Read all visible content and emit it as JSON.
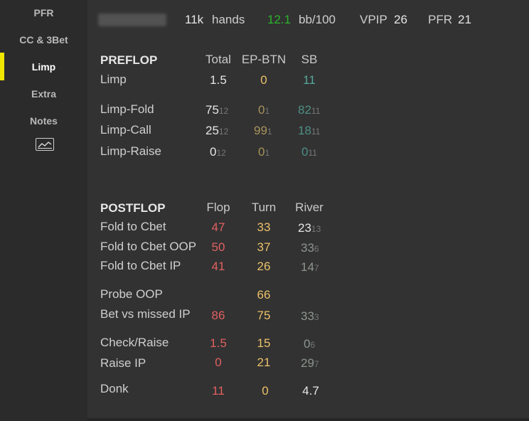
{
  "sidebar": {
    "items": [
      {
        "label": "PFR"
      },
      {
        "label": "CC & 3Bet"
      },
      {
        "label": "Limp"
      },
      {
        "label": "Extra"
      },
      {
        "label": "Notes"
      }
    ],
    "active": "Limp",
    "chart_icon": "line-chart-icon"
  },
  "header": {
    "hands_value": "11k",
    "hands_label": "hands",
    "bb100_value": "12.1",
    "bb100_label": "bb/100",
    "vpip_label": "VPIP",
    "vpip_value": "26",
    "pfr_label": "PFR",
    "pfr_value": "21"
  },
  "preflop": {
    "title": "PREFLOP",
    "columns": [
      "Total",
      "EP-BTN",
      "SB"
    ],
    "rows": [
      {
        "label": "Limp",
        "cells": [
          {
            "v": "1.5"
          },
          {
            "v": "0"
          },
          {
            "v": "11"
          }
        ]
      },
      {
        "label": "Limp-Fold",
        "cells": [
          {
            "v": "75",
            "s": "12"
          },
          {
            "v": "0",
            "s": "1"
          },
          {
            "v": "82",
            "s": "11"
          }
        ]
      },
      {
        "label": "Limp-Call",
        "cells": [
          {
            "v": "25",
            "s": "12"
          },
          {
            "v": "99",
            "s": "1"
          },
          {
            "v": "18",
            "s": "11"
          }
        ]
      },
      {
        "label": "Limp-Raise",
        "cells": [
          {
            "v": "0",
            "s": "12"
          },
          {
            "v": "0",
            "s": "1"
          },
          {
            "v": "0",
            "s": "11"
          }
        ]
      }
    ]
  },
  "postflop": {
    "title": "POSTFLOP",
    "columns": [
      "Flop",
      "Turn",
      "River"
    ],
    "rows": [
      {
        "label": "Fold to Cbet",
        "cells": [
          {
            "v": "47"
          },
          {
            "v": "33"
          },
          {
            "v": "23",
            "s": "13"
          }
        ]
      },
      {
        "label": "Fold to Cbet OOP",
        "cells": [
          {
            "v": "50"
          },
          {
            "v": "37"
          },
          {
            "v": "33",
            "s": "6"
          }
        ]
      },
      {
        "label": "Fold to Cbet IP",
        "cells": [
          {
            "v": "41"
          },
          {
            "v": "26"
          },
          {
            "v": "14",
            "s": "7"
          }
        ]
      },
      {
        "label": "Probe OOP",
        "cells": [
          {
            "v": ""
          },
          {
            "v": "66"
          },
          {
            "v": ""
          }
        ]
      },
      {
        "label": "Bet vs missed IP",
        "cells": [
          {
            "v": "86"
          },
          {
            "v": "75"
          },
          {
            "v": "33",
            "s": "3"
          }
        ]
      },
      {
        "label": "Check/Raise",
        "cells": [
          {
            "v": "1.5"
          },
          {
            "v": "15"
          },
          {
            "v": "0",
            "s": "6"
          }
        ]
      },
      {
        "label": "Raise IP",
        "cells": [
          {
            "v": "0"
          },
          {
            "v": "21"
          },
          {
            "v": "29",
            "s": "7"
          }
        ]
      },
      {
        "label": "Donk",
        "cells": [
          {
            "v": "11"
          },
          {
            "v": "0"
          },
          {
            "v": "4.7"
          }
        ]
      }
    ]
  },
  "colors": {
    "active_indicator": "#f0e600",
    "positive": "#2bb52b",
    "red": "#e06060",
    "yellow": "#ecc06a",
    "teal": "#56a89a"
  }
}
